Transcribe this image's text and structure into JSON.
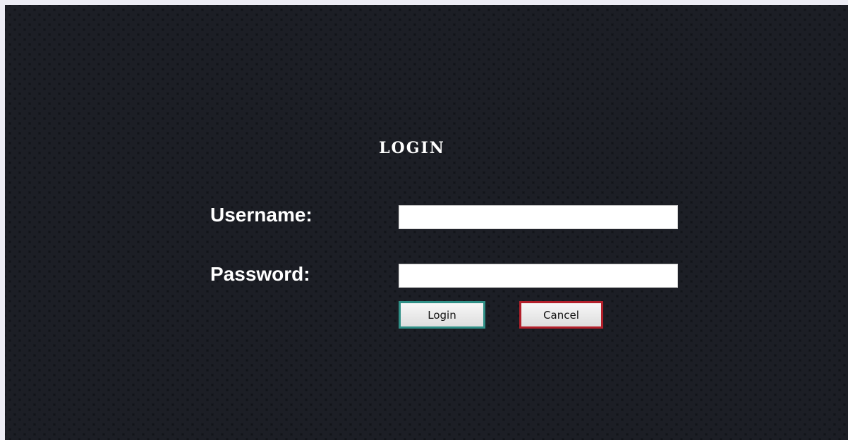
{
  "form": {
    "title": "LOGIN",
    "username_label": "Username:",
    "password_label": "Password:",
    "username_value": "",
    "password_value": "",
    "login_button": "Login",
    "cancel_button": "Cancel"
  },
  "colors": {
    "background": "#121419",
    "login_border": "#2f8f86",
    "cancel_border": "#b3202b"
  }
}
